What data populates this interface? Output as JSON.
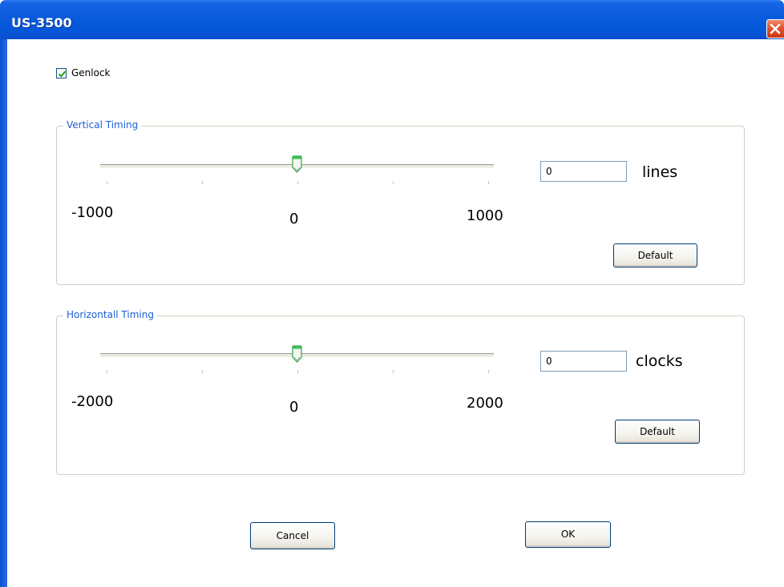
{
  "window": {
    "title": "US-3500"
  },
  "genlock": {
    "label": "Genlock",
    "checked": true
  },
  "vertical_timing": {
    "legend": "Vertical Timing",
    "min_label": "-1000",
    "mid_label": "0",
    "max_label": "1000",
    "value": "0",
    "unit": "lines",
    "default_label": "Default"
  },
  "horizontal_timing": {
    "legend": "Horizontall Timing",
    "min_label": "-2000",
    "mid_label": "0",
    "max_label": "2000",
    "value": "0",
    "unit": "clocks",
    "default_label": "Default"
  },
  "footer": {
    "cancel_label": "Cancel",
    "ok_label": "OK"
  },
  "colors": {
    "titlebar": "#0656d8",
    "legend_text": "#1d5fd8",
    "slider_thumb": "#27a844",
    "close_button": "#e0502c"
  }
}
